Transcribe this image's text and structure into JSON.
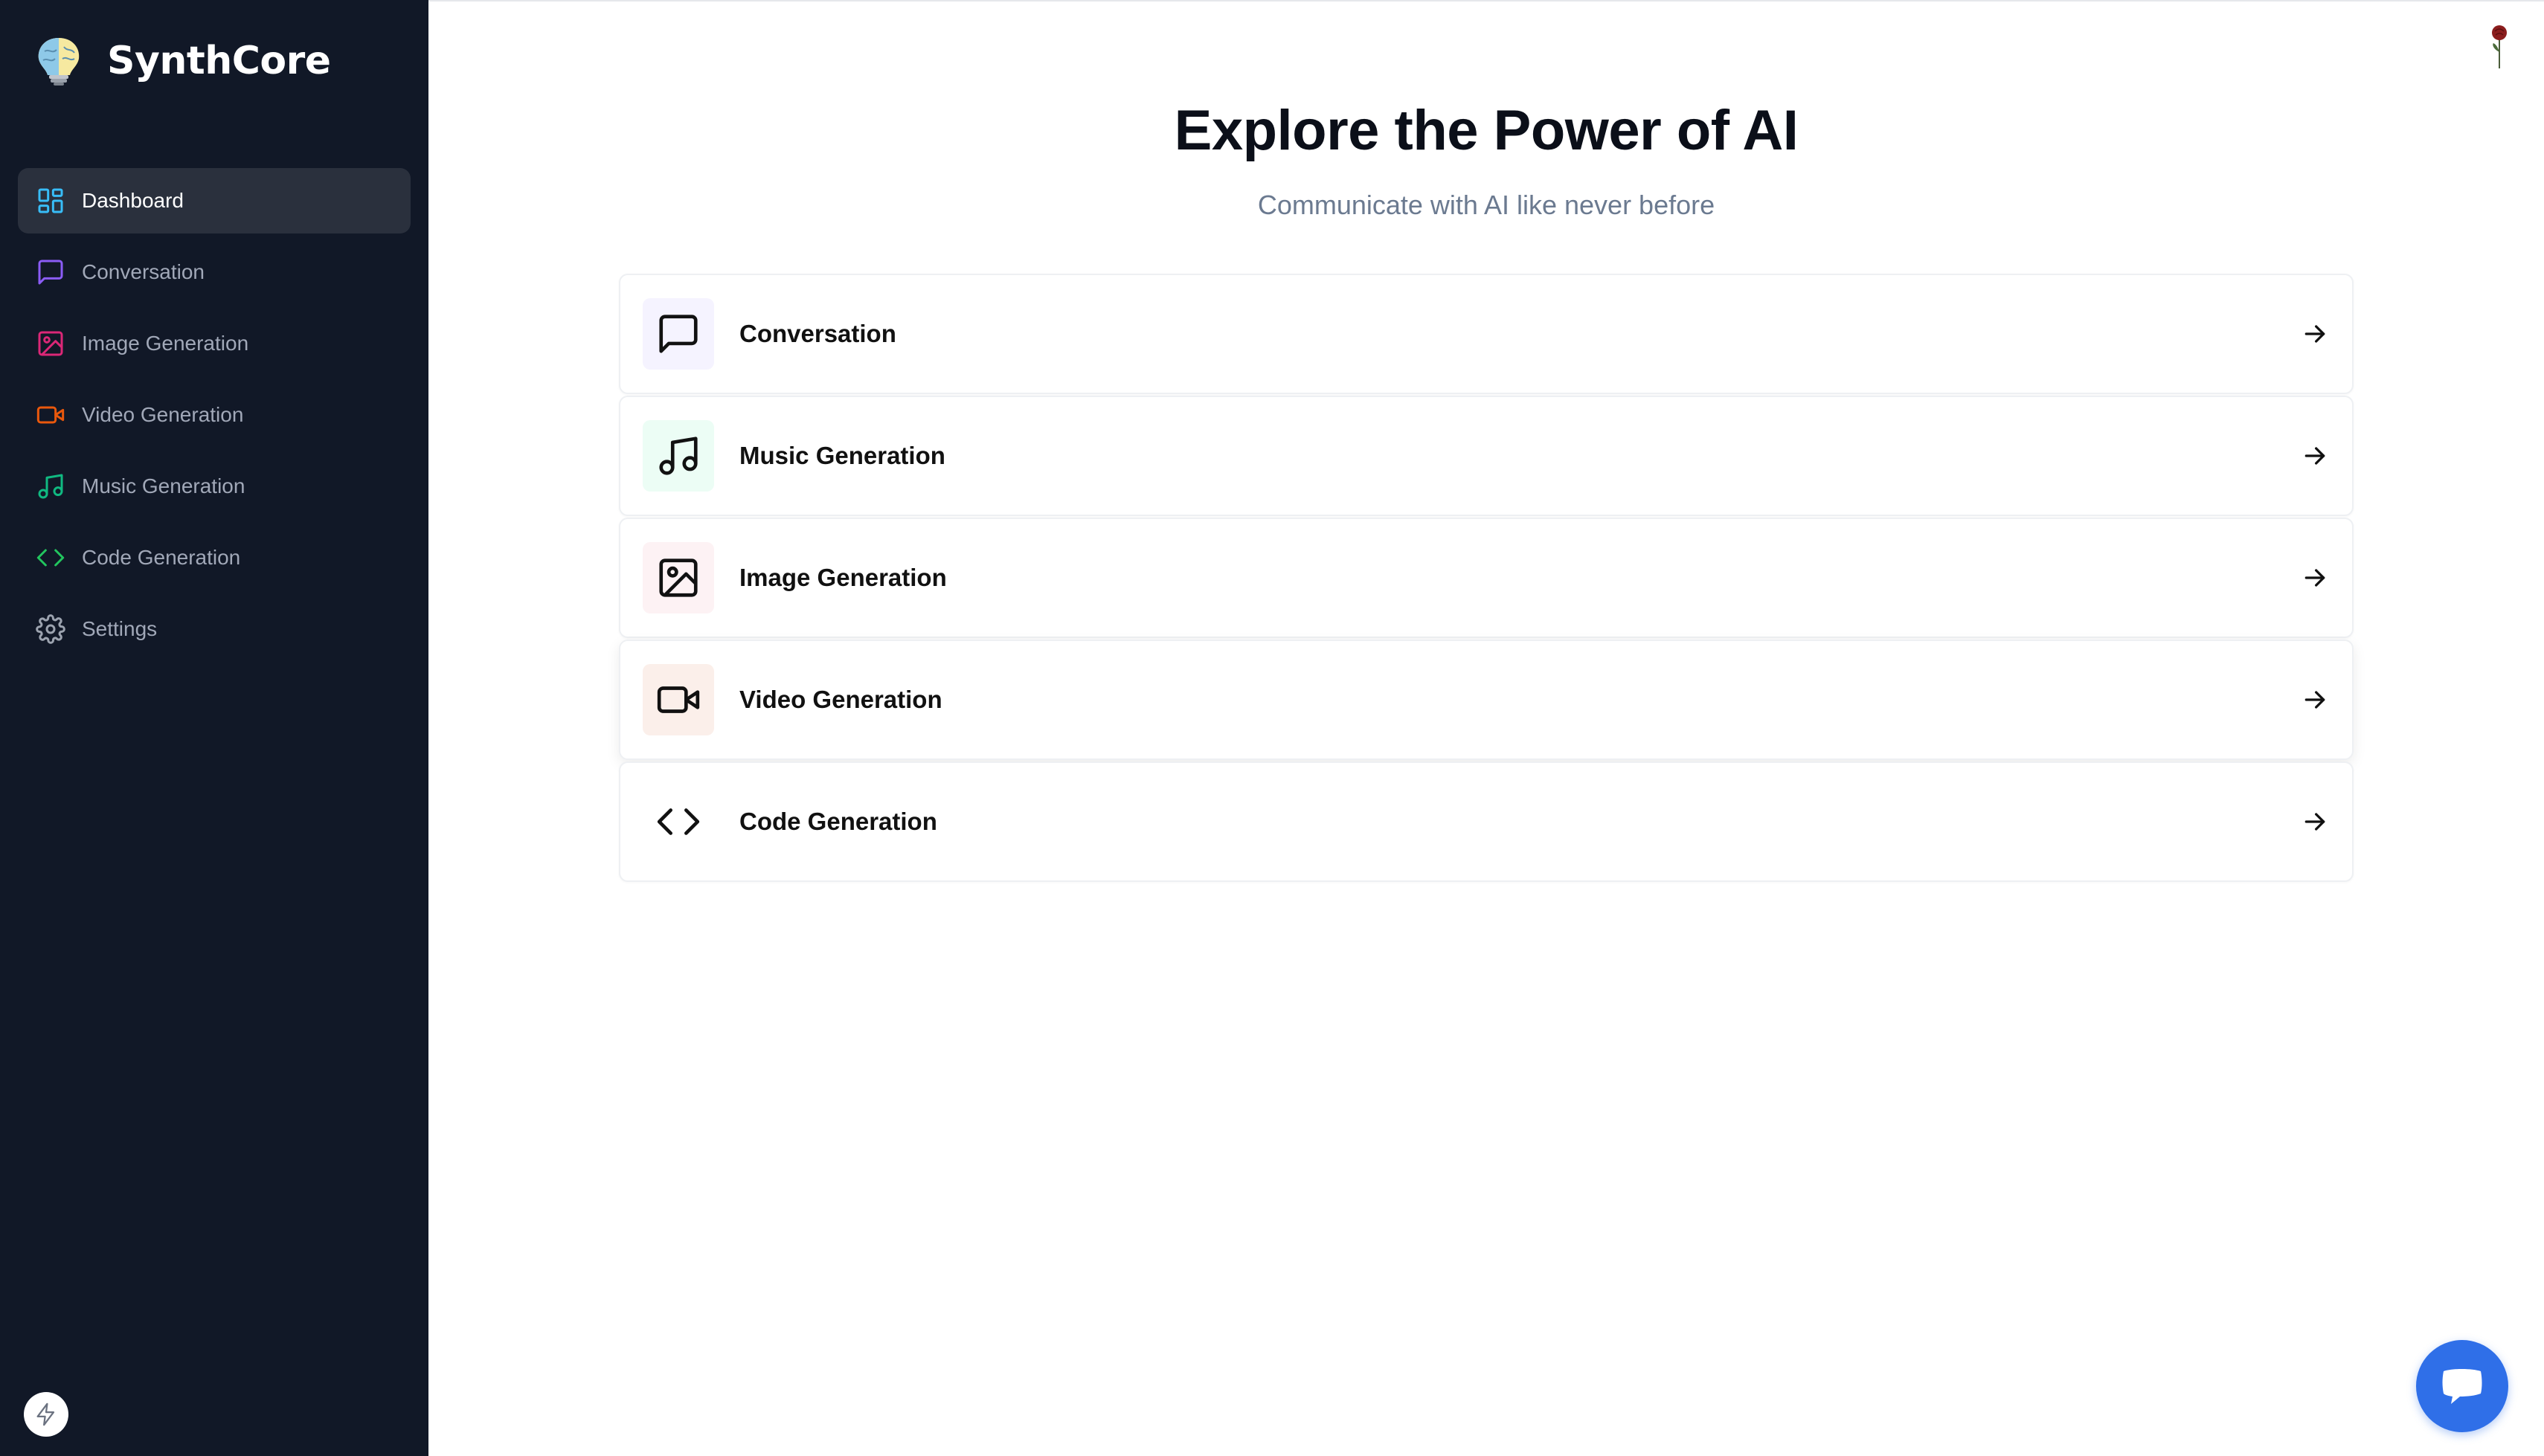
{
  "brand": {
    "name": "SynthCore",
    "logo_icon": "brain-bulb-icon"
  },
  "sidebar": {
    "items": [
      {
        "label": "Dashboard",
        "icon": "dashboard-icon",
        "color": "#38bdf8",
        "active": true
      },
      {
        "label": "Conversation",
        "icon": "message-square-icon",
        "color": "#8b5cf6",
        "active": false
      },
      {
        "label": "Image Generation",
        "icon": "image-icon",
        "color": "#db2777",
        "active": false
      },
      {
        "label": "Video Generation",
        "icon": "video-icon",
        "color": "#ea580c",
        "active": false
      },
      {
        "label": "Music Generation",
        "icon": "music-icon",
        "color": "#10b981",
        "active": false
      },
      {
        "label": "Code Generation",
        "icon": "code-icon",
        "color": "#22c55e",
        "active": false
      },
      {
        "label": "Settings",
        "icon": "gear-icon",
        "color": "#9ca3af",
        "active": false
      }
    ],
    "footer_badge_icon": "bolt-icon"
  },
  "hero": {
    "title": "Explore the Power of AI",
    "subtitle": "Communicate with AI like never before"
  },
  "tools": [
    {
      "label": "Conversation",
      "icon": "message-square-icon",
      "bg": "#f5f3ff"
    },
    {
      "label": "Music Generation",
      "icon": "music-icon",
      "bg": "#ecfdf5"
    },
    {
      "label": "Image Generation",
      "icon": "image-icon",
      "bg": "#fdf2f4"
    },
    {
      "label": "Video Generation",
      "icon": "video-icon",
      "bg": "#fbefea"
    },
    {
      "label": "Code Generation",
      "icon": "code-icon",
      "bg": "#ffffff"
    }
  ],
  "user": {
    "avatar_icon": "rose-avatar-icon"
  },
  "chat_widget": {
    "icon": "chat-bubble-icon",
    "color": "#2f6fe8"
  }
}
